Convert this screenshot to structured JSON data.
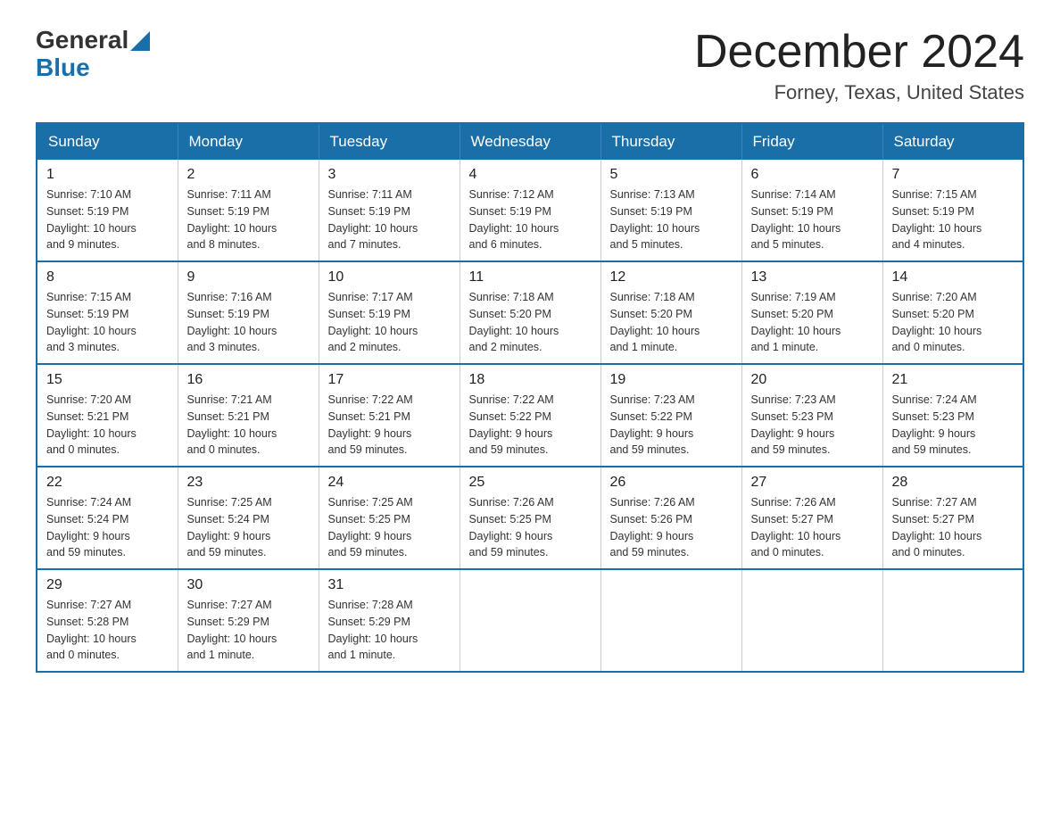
{
  "header": {
    "logo_general": "General",
    "logo_blue": "Blue",
    "month_title": "December 2024",
    "location": "Forney, Texas, United States"
  },
  "days_of_week": [
    "Sunday",
    "Monday",
    "Tuesday",
    "Wednesday",
    "Thursday",
    "Friday",
    "Saturday"
  ],
  "weeks": [
    [
      {
        "day": "1",
        "info": "Sunrise: 7:10 AM\nSunset: 5:19 PM\nDaylight: 10 hours\nand 9 minutes."
      },
      {
        "day": "2",
        "info": "Sunrise: 7:11 AM\nSunset: 5:19 PM\nDaylight: 10 hours\nand 8 minutes."
      },
      {
        "day": "3",
        "info": "Sunrise: 7:11 AM\nSunset: 5:19 PM\nDaylight: 10 hours\nand 7 minutes."
      },
      {
        "day": "4",
        "info": "Sunrise: 7:12 AM\nSunset: 5:19 PM\nDaylight: 10 hours\nand 6 minutes."
      },
      {
        "day": "5",
        "info": "Sunrise: 7:13 AM\nSunset: 5:19 PM\nDaylight: 10 hours\nand 5 minutes."
      },
      {
        "day": "6",
        "info": "Sunrise: 7:14 AM\nSunset: 5:19 PM\nDaylight: 10 hours\nand 5 minutes."
      },
      {
        "day": "7",
        "info": "Sunrise: 7:15 AM\nSunset: 5:19 PM\nDaylight: 10 hours\nand 4 minutes."
      }
    ],
    [
      {
        "day": "8",
        "info": "Sunrise: 7:15 AM\nSunset: 5:19 PM\nDaylight: 10 hours\nand 3 minutes."
      },
      {
        "day": "9",
        "info": "Sunrise: 7:16 AM\nSunset: 5:19 PM\nDaylight: 10 hours\nand 3 minutes."
      },
      {
        "day": "10",
        "info": "Sunrise: 7:17 AM\nSunset: 5:19 PM\nDaylight: 10 hours\nand 2 minutes."
      },
      {
        "day": "11",
        "info": "Sunrise: 7:18 AM\nSunset: 5:20 PM\nDaylight: 10 hours\nand 2 minutes."
      },
      {
        "day": "12",
        "info": "Sunrise: 7:18 AM\nSunset: 5:20 PM\nDaylight: 10 hours\nand 1 minute."
      },
      {
        "day": "13",
        "info": "Sunrise: 7:19 AM\nSunset: 5:20 PM\nDaylight: 10 hours\nand 1 minute."
      },
      {
        "day": "14",
        "info": "Sunrise: 7:20 AM\nSunset: 5:20 PM\nDaylight: 10 hours\nand 0 minutes."
      }
    ],
    [
      {
        "day": "15",
        "info": "Sunrise: 7:20 AM\nSunset: 5:21 PM\nDaylight: 10 hours\nand 0 minutes."
      },
      {
        "day": "16",
        "info": "Sunrise: 7:21 AM\nSunset: 5:21 PM\nDaylight: 10 hours\nand 0 minutes."
      },
      {
        "day": "17",
        "info": "Sunrise: 7:22 AM\nSunset: 5:21 PM\nDaylight: 9 hours\nand 59 minutes."
      },
      {
        "day": "18",
        "info": "Sunrise: 7:22 AM\nSunset: 5:22 PM\nDaylight: 9 hours\nand 59 minutes."
      },
      {
        "day": "19",
        "info": "Sunrise: 7:23 AM\nSunset: 5:22 PM\nDaylight: 9 hours\nand 59 minutes."
      },
      {
        "day": "20",
        "info": "Sunrise: 7:23 AM\nSunset: 5:23 PM\nDaylight: 9 hours\nand 59 minutes."
      },
      {
        "day": "21",
        "info": "Sunrise: 7:24 AM\nSunset: 5:23 PM\nDaylight: 9 hours\nand 59 minutes."
      }
    ],
    [
      {
        "day": "22",
        "info": "Sunrise: 7:24 AM\nSunset: 5:24 PM\nDaylight: 9 hours\nand 59 minutes."
      },
      {
        "day": "23",
        "info": "Sunrise: 7:25 AM\nSunset: 5:24 PM\nDaylight: 9 hours\nand 59 minutes."
      },
      {
        "day": "24",
        "info": "Sunrise: 7:25 AM\nSunset: 5:25 PM\nDaylight: 9 hours\nand 59 minutes."
      },
      {
        "day": "25",
        "info": "Sunrise: 7:26 AM\nSunset: 5:25 PM\nDaylight: 9 hours\nand 59 minutes."
      },
      {
        "day": "26",
        "info": "Sunrise: 7:26 AM\nSunset: 5:26 PM\nDaylight: 9 hours\nand 59 minutes."
      },
      {
        "day": "27",
        "info": "Sunrise: 7:26 AM\nSunset: 5:27 PM\nDaylight: 10 hours\nand 0 minutes."
      },
      {
        "day": "28",
        "info": "Sunrise: 7:27 AM\nSunset: 5:27 PM\nDaylight: 10 hours\nand 0 minutes."
      }
    ],
    [
      {
        "day": "29",
        "info": "Sunrise: 7:27 AM\nSunset: 5:28 PM\nDaylight: 10 hours\nand 0 minutes."
      },
      {
        "day": "30",
        "info": "Sunrise: 7:27 AM\nSunset: 5:29 PM\nDaylight: 10 hours\nand 1 minute."
      },
      {
        "day": "31",
        "info": "Sunrise: 7:28 AM\nSunset: 5:29 PM\nDaylight: 10 hours\nand 1 minute."
      },
      null,
      null,
      null,
      null
    ]
  ]
}
